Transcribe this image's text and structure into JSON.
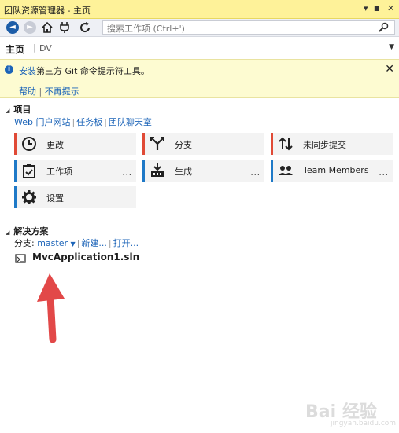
{
  "window": {
    "title": "团队资源管理器 - 主页",
    "controls": [
      "▾",
      "■",
      "✕"
    ]
  },
  "toolbar": {
    "search_placeholder": "搜索工作项 (Ctrl+')",
    "search_icon": "search-icon"
  },
  "header": {
    "title": "主页",
    "subtitle": "DV"
  },
  "notice": {
    "link_text": "安装",
    "message": "第三方 Git 命令提示符工具。",
    "help": "帮助",
    "dismiss": "不再提示",
    "separator": "|"
  },
  "project": {
    "section_title": "项目",
    "links": [
      "Web 门户网站",
      "任务板",
      "团队聊天室"
    ],
    "tiles": [
      {
        "label": "更改",
        "icon": "clock-icon",
        "color": "#e04a36"
      },
      {
        "label": "分支",
        "icon": "branch-icon",
        "color": "#e04a36"
      },
      {
        "label": "未同步提交",
        "icon": "sync-arrows-icon",
        "color": "#e04a36"
      },
      {
        "label": "工作项",
        "icon": "clipboard-check-icon",
        "color": "#1e79c7"
      },
      {
        "label": "生成",
        "icon": "build-icon",
        "color": "#1e79c7"
      },
      {
        "label": "Team Members",
        "icon": "people-icon",
        "color": "#1e79c7"
      },
      {
        "label": "设置",
        "icon": "gear-icon",
        "color": "#1e79c7"
      }
    ],
    "more_label": "..."
  },
  "solutions": {
    "section_title": "解决方案",
    "branch_label": "分支:",
    "branch_value": "master",
    "new_label": "新建...",
    "open_label": "打开...",
    "file_name": "MvcApplication1.sln"
  },
  "watermark": {
    "text": "Bai 经验",
    "sub": "jingyan.baidu.com"
  },
  "colors": {
    "title_bar": "#fef299",
    "link": "#1c64b8",
    "accent_red": "#e04a36",
    "accent_blue": "#1e79c7",
    "annotation_arrow": "#e24848"
  }
}
